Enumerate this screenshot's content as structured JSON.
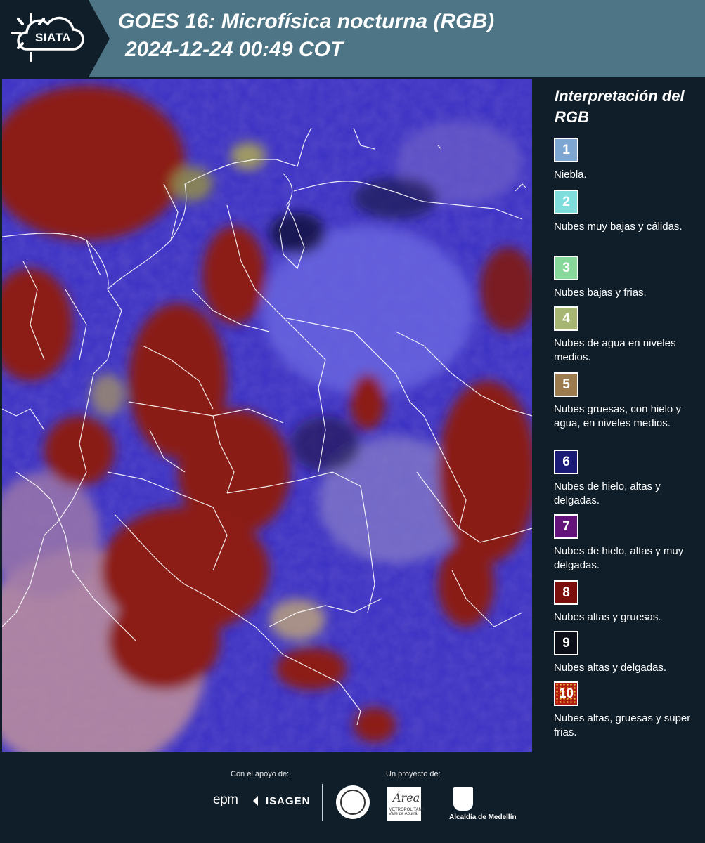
{
  "header": {
    "logo_text": "SIATA",
    "title_line1": "GOES 16: Microfísica nocturna (RGB)",
    "title_line2": "2024-12-24 00:49 COT"
  },
  "legend": {
    "title": "Interpretación del RGB",
    "items": [
      {
        "number": "1",
        "label": "Niebla.",
        "color": "#7ea6d3"
      },
      {
        "number": "2",
        "label": "Nubes muy bajas y cálidas.",
        "color": "#7fdedc"
      },
      {
        "number": "3",
        "label": "Nubes bajas y frias.",
        "color": "#86d99a"
      },
      {
        "number": "4",
        "label": "Nubes de agua en niveles medios.",
        "color": "#a7b672"
      },
      {
        "number": "5",
        "label": "Nubes gruesas, con hielo y agua, en niveles medios.",
        "color": "#9c7c4e"
      },
      {
        "number": "6",
        "label": "Nubes de hielo, altas y delgadas.",
        "color": "#1b1a78"
      },
      {
        "number": "7",
        "label": "Nubes de hielo, altas y muy delgadas.",
        "color": "#64137a"
      },
      {
        "number": "8",
        "label": "Nubes altas y gruesas.",
        "color": "#7c0f0c"
      },
      {
        "number": "9",
        "label": "Nubes altas y delgadas.",
        "color": "#0d0f18"
      },
      {
        "number": "10",
        "label": "Nubes altas, gruesas y super frias.",
        "color": "#b21c10"
      }
    ]
  },
  "footer": {
    "support_label": "Con el apoyo de:",
    "project_label": "Un proyecto de:",
    "sponsor_epm": "epm",
    "sponsor_isagen": "ISAGEN",
    "area_logo_text": "Área",
    "area_logo_sub": "METROPOLITANA Valle de Aburrá",
    "alcaldia_label": "Alcaldía de Medellín"
  },
  "colors": {
    "header_bg": "#4e7585",
    "panel_bg": "#0f1e29",
    "map_blue": "#3b2fc8",
    "map_red": "#8a1a12",
    "map_pink": "#b07a9a"
  }
}
